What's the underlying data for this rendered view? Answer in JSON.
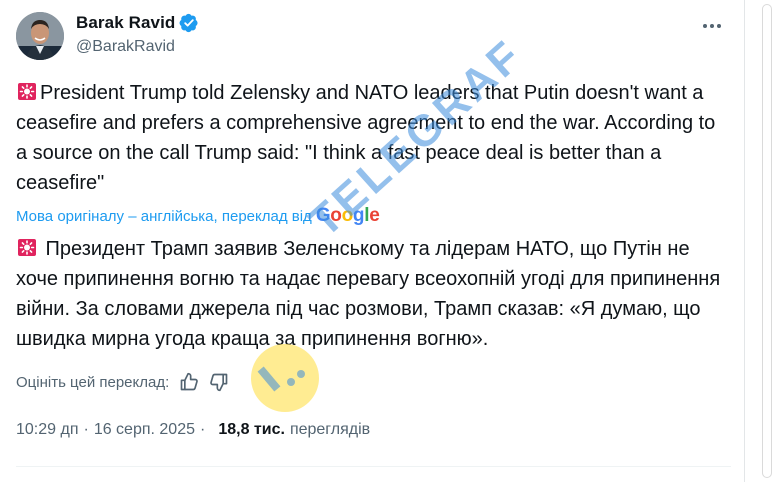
{
  "author": {
    "display_name": "Barak Ravid",
    "handle": "@BarakRavid",
    "verified": true
  },
  "post": {
    "text": "President Trump told Zelensky and NATO leaders that Putin doesn't want a ceasefire and prefers a comprehensive agreement to end the war. According to a source on the call Trump said: \"I think a fast peace deal is better than a ceasefire\"",
    "leading_emoji": "siren-icon"
  },
  "translation": {
    "label": "Мова оригіналу – англійська, переклад від",
    "provider": "Google",
    "text": " Президент Трамп заявив Зеленському та лідерам НАТО, що Путін не хоче припинення вогню та надає перевагу всеохопній угоді для припинення війни. За словами джерела під час розмови, Трамп сказав: «Я думаю, що швидка мирна угода краща за припинення вогню».",
    "rate_label": "Оцініть цей переклад:"
  },
  "meta": {
    "time": "10:29 дп",
    "date": "16 серп. 2025",
    "views_count": "18,8 тис.",
    "views_label": "переглядів"
  },
  "watermark": {
    "text": "TELEGRAF"
  },
  "colors": {
    "link": "#1d9bf0",
    "secondary_text": "#536471",
    "verified_badge": "#1d9bf0"
  }
}
